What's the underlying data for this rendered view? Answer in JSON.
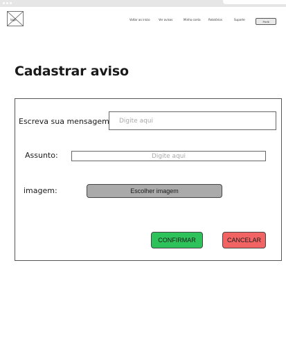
{
  "header": {
    "logo_text": "logo",
    "nav": [
      "Voltar ao início",
      "Ver avisos",
      "Minha conta",
      "Relatórios",
      "Suporte"
    ],
    "profile_label": "Perfil"
  },
  "page": {
    "title": "Cadastrar aviso"
  },
  "form": {
    "message_label": "Escreva sua mensagem:",
    "message_placeholder": "Digite aqui",
    "subject_label": "Assunto:",
    "subject_placeholder": "Digite aqui",
    "image_label": "imagem:",
    "image_button": "Escolher imagem",
    "confirm_label": "CONFIRMAR",
    "cancel_label": "CANCELAR"
  },
  "colors": {
    "confirm": "#2ec35a",
    "cancel": "#f26363",
    "choose_image": "#aaaaaa"
  }
}
